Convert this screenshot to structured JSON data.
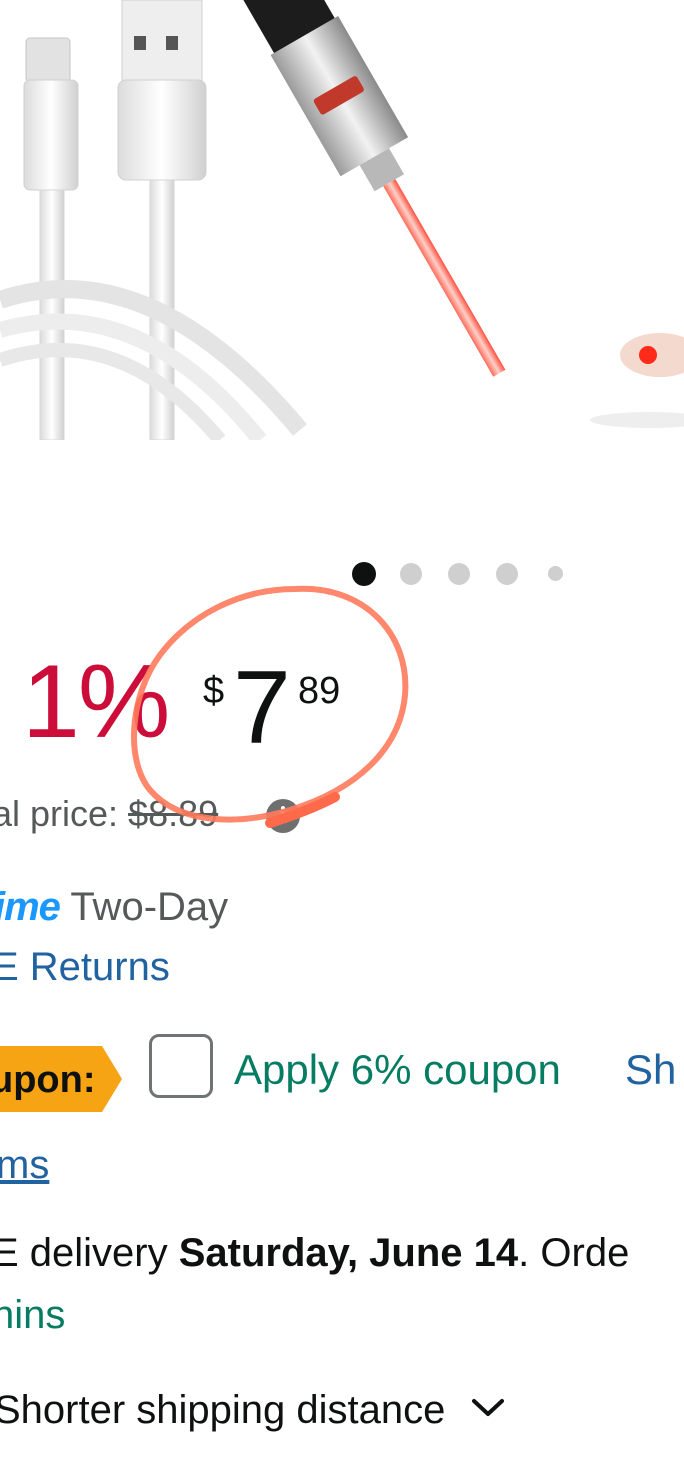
{
  "product": {
    "image_alt": "USB charging cable and laser pointer with cat toy",
    "carousel": {
      "total": 5,
      "active": 0
    }
  },
  "price": {
    "discount": "1%",
    "currency_symbol": "$",
    "whole": "7",
    "fraction": "89",
    "list_price_label": "al price: ",
    "list_price": "$8.89",
    "info_icon": "info-icon"
  },
  "shipping": {
    "prime_label": "ime",
    "prime_suffix": " Two-Day",
    "free_returns": "E Returns"
  },
  "coupon": {
    "badge": "upon:",
    "apply_label": "Apply 6% coupon",
    "shop_label": "Sh",
    "terms_label": "ms"
  },
  "delivery": {
    "prefix": "E delivery ",
    "date": "Saturday, June 14",
    "suffix": ". Orde",
    "countdown": "nins",
    "shorter_shipping": "Shorter shipping distance",
    "chevron_icon": "chevron-down-icon"
  },
  "colors": {
    "discount_red": "#cc0c39",
    "prime_blue": "#1a98ff",
    "link_blue": "#2162a1",
    "green": "#067d62",
    "coupon_orange": "#f7a414",
    "annotation": "#ff7b5c"
  }
}
